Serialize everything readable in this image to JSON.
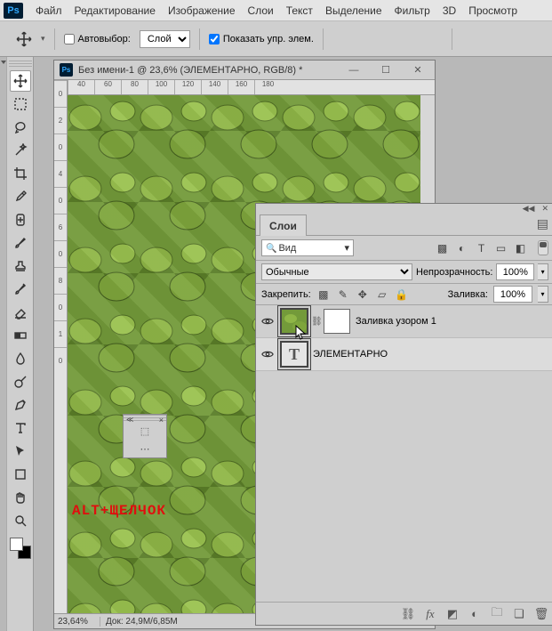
{
  "menu": {
    "logo": "Ps",
    "items": [
      "Файл",
      "Редактирование",
      "Изображение",
      "Слои",
      "Текст",
      "Выделение",
      "Фильтр",
      "3D",
      "Просмотр"
    ]
  },
  "options": {
    "autoselect_label": "Автовыбор:",
    "autoselect_checked": false,
    "target_select": "Слой",
    "show_controls_label": "Показать упр. элем.",
    "show_controls_checked": true
  },
  "document": {
    "title": "Без имени-1 @ 23,6% (ЭЛЕМЕНТАРНО, RGB/8) *",
    "ruler_h": [
      "40",
      "60",
      "80",
      "100",
      "120",
      "140",
      "160",
      "180"
    ],
    "ruler_v": [
      "0",
      "2",
      "0",
      "4",
      "0",
      "6",
      "0",
      "8",
      "0",
      "1",
      "0"
    ],
    "zoom_status": "23,64%",
    "doc_info_label": "Док:",
    "doc_info_value": "24,9M/6,85M"
  },
  "hint": "ALT+ЩЕЛЧОК",
  "layers_panel": {
    "tab": "Слои",
    "search_label": "Вид",
    "blend_mode": "Обычные",
    "opacity_label": "Непрозрачность:",
    "opacity_value": "100%",
    "lock_label": "Закрепить:",
    "fill_label": "Заливка:",
    "fill_value": "100%",
    "layers": [
      {
        "name": "Заливка узором 1",
        "type": "pattern",
        "selected": false
      },
      {
        "name": "ЭЛЕМЕНТАРНО",
        "type": "text",
        "selected": true
      }
    ],
    "filter_icons": [
      "image-icon",
      "adjust-icon",
      "text-icon",
      "shape-icon",
      "smart-icon"
    ],
    "footer_icons": [
      "link-icon",
      "fx-icon",
      "mask-icon",
      "adjustlayer-icon",
      "group-icon",
      "newlayer-icon",
      "trash-icon"
    ]
  }
}
